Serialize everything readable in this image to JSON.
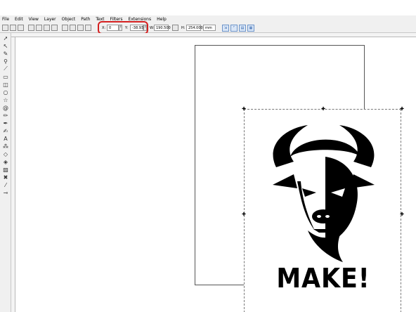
{
  "menu": [
    "File",
    "Edit",
    "View",
    "Layer",
    "Object",
    "Path",
    "Text",
    "Filters",
    "Extensions",
    "Help"
  ],
  "toolbar": {
    "x_label": "X:",
    "x_value": "0",
    "y_label": "Y:",
    "y_value": "-38.932",
    "w_label": "W:",
    "w_value": "190.500",
    "h_label": "H:",
    "h_value": "254.000",
    "unit": "mm",
    "lock_icon": "lock-icon",
    "transform_icons": [
      "scale-stroke-icon",
      "scale-corners-icon",
      "move-gradients-icon",
      "move-patterns-icon"
    ]
  },
  "highlight_color": "#d42020",
  "canvas": {
    "logo_text": "MAKE!"
  },
  "tools": [
    "select-arrow-icon",
    "node-edit-icon",
    "tweak-icon",
    "zoom-icon",
    "measure-icon",
    "rectangle-icon",
    "3d-box-icon",
    "ellipse-icon",
    "star-icon",
    "spiral-icon",
    "pencil-icon",
    "pen-icon",
    "calligraphy-icon",
    "text-icon",
    "spray-icon",
    "eraser-icon",
    "paint-bucket-icon",
    "gradient-icon",
    "mesh-icon",
    "dropper-icon",
    "connector-icon"
  ]
}
